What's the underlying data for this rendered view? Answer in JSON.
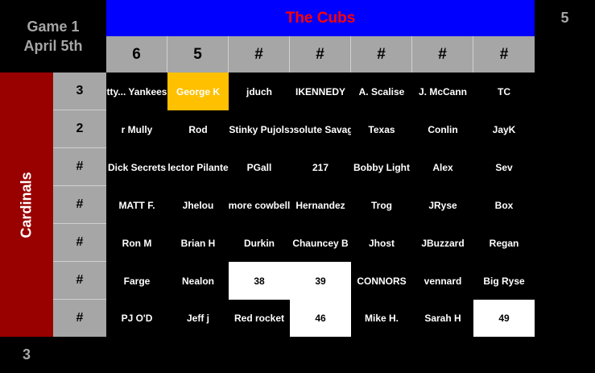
{
  "game": {
    "line1": "Game 1",
    "line2": "April 5th"
  },
  "top_team": {
    "name": "The Cubs",
    "score": "5"
  },
  "side_team": {
    "name": "Cardinals",
    "score": "3"
  },
  "column_headers": [
    "6",
    "5",
    "#",
    "#",
    "#",
    "#",
    "#"
  ],
  "row_headers": [
    "3",
    "2",
    "#",
    "#",
    "#",
    "#",
    "#"
  ],
  "grid": [
    [
      {
        "t": "tty... Yankees",
        "s": ""
      },
      {
        "t": "George K",
        "s": "gold"
      },
      {
        "t": "jduch",
        "s": ""
      },
      {
        "t": "IKENNEDY",
        "s": ""
      },
      {
        "t": "A. Scalise",
        "s": ""
      },
      {
        "t": "J. McCann",
        "s": ""
      },
      {
        "t": "TC",
        "s": ""
      }
    ],
    [
      {
        "t": "r Mully",
        "s": ""
      },
      {
        "t": "Rod",
        "s": ""
      },
      {
        "t": "Stinky Pujols",
        "s": ""
      },
      {
        "t": "bsolute Savag",
        "s": ""
      },
      {
        "t": "Texas",
        "s": ""
      },
      {
        "t": "Conlin",
        "s": ""
      },
      {
        "t": "JayK",
        "s": ""
      }
    ],
    [
      {
        "t": "Dick Secrets",
        "s": ""
      },
      {
        "t": "lector Pilante",
        "s": ""
      },
      {
        "t": "PGall",
        "s": ""
      },
      {
        "t": "217",
        "s": ""
      },
      {
        "t": "Bobby Light",
        "s": ""
      },
      {
        "t": "Alex",
        "s": ""
      },
      {
        "t": "Sev",
        "s": ""
      }
    ],
    [
      {
        "t": "MATT F.",
        "s": ""
      },
      {
        "t": "Jhelou",
        "s": ""
      },
      {
        "t": "more cowbell",
        "s": ""
      },
      {
        "t": "Hernandez",
        "s": ""
      },
      {
        "t": "Trog",
        "s": ""
      },
      {
        "t": "JRyse",
        "s": ""
      },
      {
        "t": "Box",
        "s": ""
      }
    ],
    [
      {
        "t": "Ron M",
        "s": ""
      },
      {
        "t": "Brian H",
        "s": ""
      },
      {
        "t": "Durkin",
        "s": ""
      },
      {
        "t": "Chauncey B",
        "s": ""
      },
      {
        "t": "Jhost",
        "s": ""
      },
      {
        "t": "JBuzzard",
        "s": ""
      },
      {
        "t": "Regan",
        "s": ""
      }
    ],
    [
      {
        "t": "Farge",
        "s": ""
      },
      {
        "t": "Nealon",
        "s": ""
      },
      {
        "t": "38",
        "s": "white"
      },
      {
        "t": "39",
        "s": "white"
      },
      {
        "t": "CONNORS",
        "s": ""
      },
      {
        "t": "vennard",
        "s": ""
      },
      {
        "t": "Big Ryse",
        "s": ""
      }
    ],
    [
      {
        "t": "PJ O'D",
        "s": ""
      },
      {
        "t": "Jeff j",
        "s": ""
      },
      {
        "t": "Red rocket",
        "s": ""
      },
      {
        "t": "46",
        "s": "white"
      },
      {
        "t": "Mike H.",
        "s": ""
      },
      {
        "t": "Sarah H",
        "s": ""
      },
      {
        "t": "49",
        "s": "white"
      }
    ]
  ],
  "colors": {
    "header_blue": "#0000ff",
    "team_red": "#ff0000",
    "cardinals_red": "#990000",
    "header_gray": "#a6a6a6",
    "highlight_gold": "#ffc000"
  }
}
